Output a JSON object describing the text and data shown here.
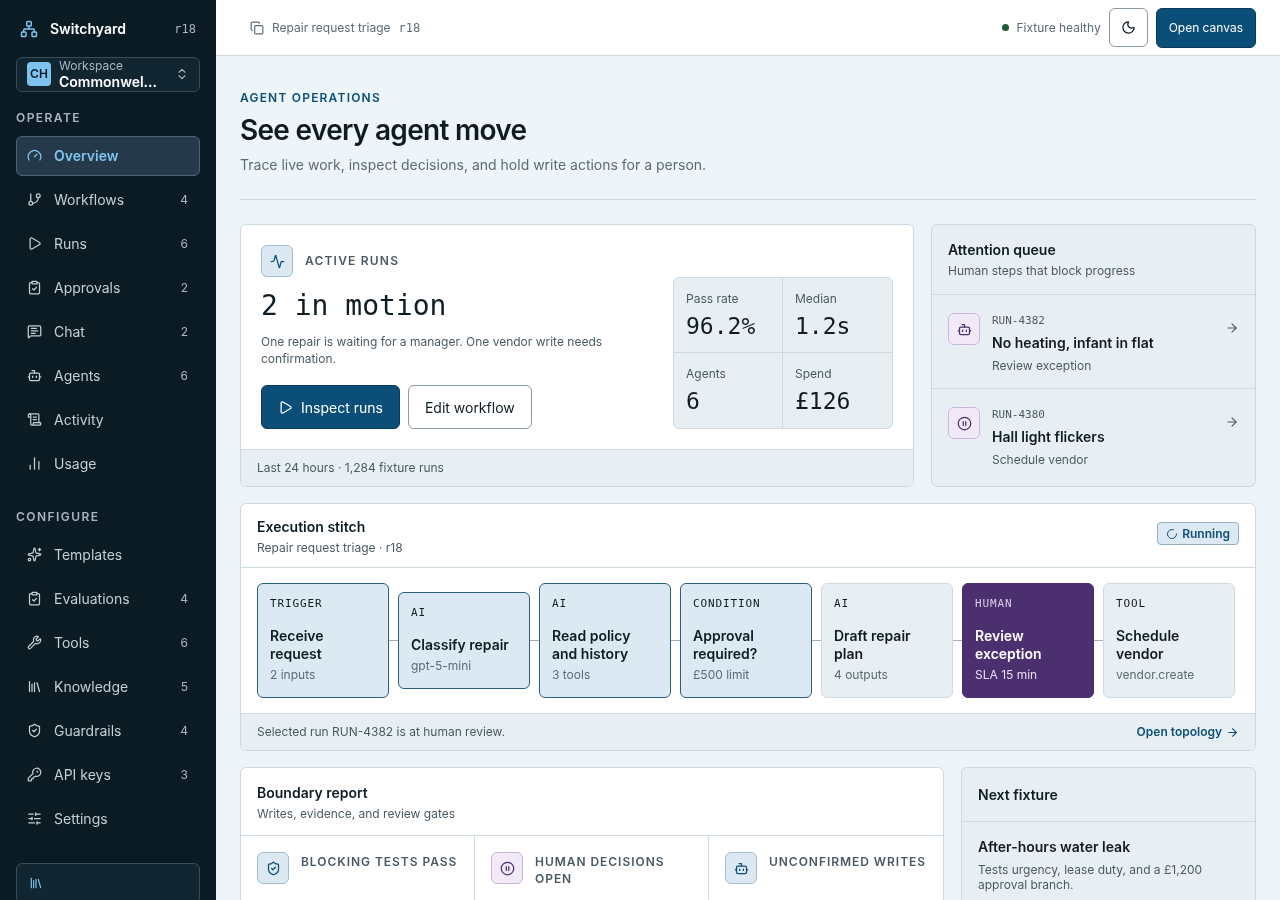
{
  "sidebar": {
    "brand": "Switchyard",
    "revision": "r18",
    "workspace": {
      "initials": "CH",
      "label": "Workspace",
      "name": "Commonwel..."
    },
    "sections": [
      {
        "title": "OPERATE",
        "items": [
          {
            "label": "Overview",
            "selected": true
          },
          {
            "label": "Workflows",
            "count": "4",
            "selected": false
          },
          {
            "label": "Runs",
            "count": "6",
            "selected": false
          },
          {
            "label": "Approvals",
            "count": "2",
            "selected": false
          },
          {
            "label": "Chat",
            "count": "2",
            "selected": false
          },
          {
            "label": "Agents",
            "count": "6",
            "selected": false
          },
          {
            "label": "Activity",
            "selected": false
          },
          {
            "label": "Usage",
            "selected": false
          }
        ]
      },
      {
        "title": "CONFIGURE",
        "items": [
          {
            "label": "Templates",
            "selected": false
          },
          {
            "label": "Evaluations",
            "count": "4",
            "selected": false
          },
          {
            "label": "Tools",
            "count": "6",
            "selected": false
          },
          {
            "label": "Knowledge",
            "count": "5",
            "selected": false
          },
          {
            "label": "Guardrails",
            "count": "4",
            "selected": false
          },
          {
            "label": "API keys",
            "count": "3",
            "selected": false
          },
          {
            "label": "Settings",
            "selected": false
          }
        ]
      }
    ]
  },
  "header": {
    "breadcrumb": "Repair request triage",
    "revision": "r18",
    "status": "Fixture healthy",
    "primary_button": "Open canvas"
  },
  "hero": {
    "eyebrow": "AGENT OPERATIONS",
    "title": "See every agent move",
    "subtitle": "Trace live work, inspect decisions, and hold write actions for a person."
  },
  "active_runs": {
    "label": "ACTIVE RUNS",
    "headline": "2 in motion",
    "description": "One repair is waiting for a manager. One vendor write needs confirmation.",
    "primary_button": "Inspect runs",
    "secondary_button": "Edit workflow",
    "footer": "Last 24 hours · 1,284 fixture runs",
    "stats": [
      {
        "label": "Pass rate",
        "value": "96.2%"
      },
      {
        "label": "Median",
        "value": "1.2s"
      },
      {
        "label": "Agents",
        "value": "6"
      },
      {
        "label": "Spend",
        "value": "£126"
      }
    ]
  },
  "attention_queue": {
    "title": "Attention queue",
    "subtitle": "Human steps that block progress",
    "items": [
      {
        "kind": "agent",
        "id": "RUN-4382",
        "title": "No heating, infant in flat",
        "action": "Review exception"
      },
      {
        "kind": "paused",
        "id": "RUN-4380",
        "title": "Hall light flickers",
        "action": "Schedule vendor"
      }
    ]
  },
  "execution": {
    "title": "Execution stitch",
    "subtitle": "Repair request triage · r18",
    "badge": "Running",
    "footer": "Selected run RUN-4382 is at human review.",
    "link": "Open topology",
    "nodes": [
      {
        "type": "TRIGGER",
        "title": "Receive request",
        "detail": "2 inputs",
        "completed": true,
        "selected": false
      },
      {
        "type": "AI",
        "title": "Classify repair",
        "detail": "gpt-5-mini",
        "completed": true,
        "selected": false
      },
      {
        "type": "AI",
        "title": "Read policy and history",
        "detail": "3 tools",
        "completed": true,
        "selected": false
      },
      {
        "type": "CONDITION",
        "title": "Approval required?",
        "detail": "£500 limit",
        "completed": true,
        "selected": false
      },
      {
        "type": "AI",
        "title": "Draft repair plan",
        "detail": "4 outputs",
        "completed": false,
        "selected": false
      },
      {
        "type": "HUMAN",
        "title": "Review exception",
        "detail": "SLA 15 min",
        "completed": false,
        "selected": true
      },
      {
        "type": "TOOL",
        "title": "Schedule vendor",
        "detail": "vendor.create",
        "completed": false,
        "selected": false
      }
    ]
  },
  "boundary": {
    "title": "Boundary report",
    "subtitle": "Writes, evidence, and review gates",
    "metrics": [
      {
        "kind": "passed",
        "label": "BLOCKING TESTS PASS"
      },
      {
        "kind": "paused",
        "label": "HUMAN DECISIONS OPEN"
      },
      {
        "kind": "agent",
        "label": "UNCONFIRMED WRITES"
      }
    ]
  },
  "next_fixture": {
    "title": "Next fixture",
    "name": "After-hours water leak",
    "description": "Tests urgency, lease duty, and a £1,200 approval branch."
  }
}
